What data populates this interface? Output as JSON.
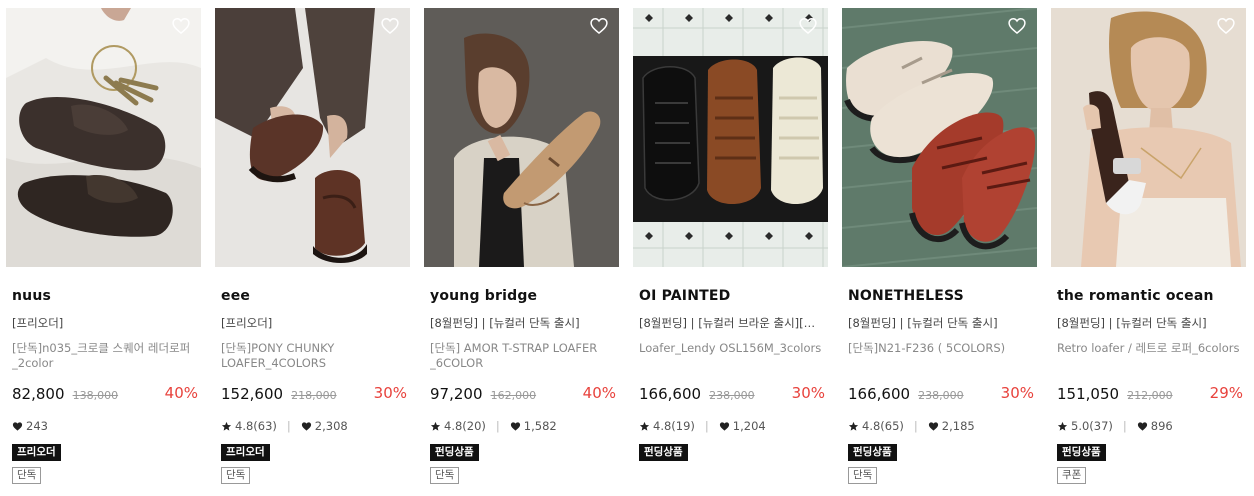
{
  "products": [
    {
      "brand": "nuus",
      "tagline": "[프리오더]",
      "name": "[단독]n035_크로클 스퀘어 레더로퍼_2color",
      "price": "82,800",
      "original_price": "138,000",
      "discount": "40%",
      "rating": "",
      "likes": "243",
      "badge_primary": "프리오더",
      "badge_secondary": "단독"
    },
    {
      "brand": "eee",
      "tagline": "[프리오더]",
      "name": "[단독]PONY CHUNKY LOAFER_4COLORS",
      "price": "152,600",
      "original_price": "218,000",
      "discount": "30%",
      "rating": "4.8(63)",
      "likes": "2,308",
      "badge_primary": "프리오더",
      "badge_secondary": "단독"
    },
    {
      "brand": "young bridge",
      "tagline": "[8월펀딩] | [뉴컬러 단독 출시]",
      "name": "[단독] AMOR T-STRAP LOAFER _6COLOR",
      "price": "97,200",
      "original_price": "162,000",
      "discount": "40%",
      "rating": "4.8(20)",
      "likes": "1,582",
      "badge_primary": "펀딩상품",
      "badge_secondary": "단독"
    },
    {
      "brand": "OI PAINTED",
      "tagline": "[8월펀딩] | [뉴컬러 브라운 출시][…",
      "name": "Loafer_Lendy OSL156M_3colors",
      "price": "166,600",
      "original_price": "238,000",
      "discount": "30%",
      "rating": "4.8(19)",
      "likes": "1,204",
      "badge_primary": "펀딩상품",
      "badge_secondary": ""
    },
    {
      "brand": "NONETHELESS",
      "tagline": "[8월펀딩] | [뉴컬러 단독 출시]",
      "name": "[단독]N21-F236 ( 5COLORS)",
      "price": "166,600",
      "original_price": "238,000",
      "discount": "30%",
      "rating": "4.8(65)",
      "likes": "2,185",
      "badge_primary": "펀딩상품",
      "badge_secondary": "단독"
    },
    {
      "brand": "the romantic ocean",
      "tagline": "[8월펀딩] | [뉴컬러 단독 출시]",
      "name": "Retro loafer / 레트로 로퍼_6colors",
      "price": "151,050",
      "original_price": "212,000",
      "discount": "29%",
      "rating": "5.0(37)",
      "likes": "896",
      "badge_primary": "펀딩상품",
      "badge_secondary": "쿠폰"
    }
  ],
  "icons": {
    "wishlist": "heart-outline-icon",
    "rating": "star-icon",
    "likes": "heart-filled-icon"
  },
  "colors": {
    "discount": "#e8423c",
    "badge_dark": "#111111"
  }
}
